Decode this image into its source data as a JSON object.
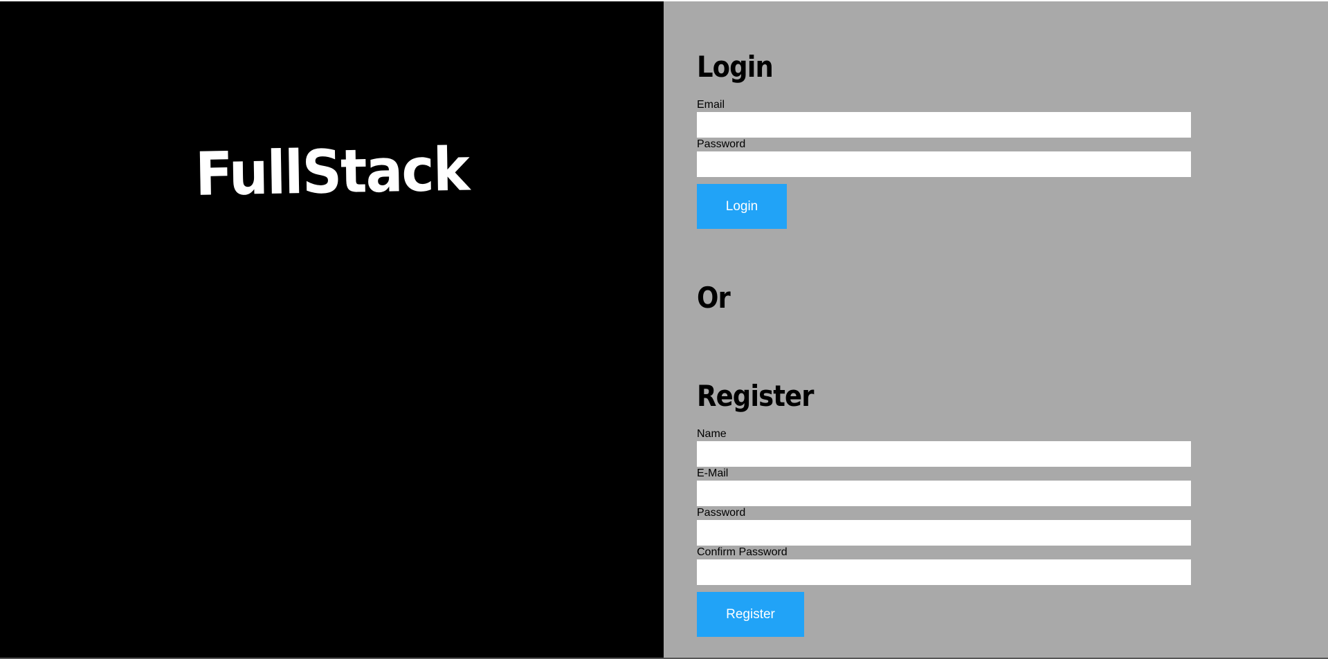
{
  "brand": {
    "title": "FullStack"
  },
  "login": {
    "heading": "Login",
    "email_label": "Email",
    "email_value": "",
    "password_label": "Password",
    "password_value": "",
    "button_label": "Login"
  },
  "separator": {
    "text": "Or"
  },
  "register": {
    "heading": "Register",
    "name_label": "Name",
    "name_value": "",
    "email_label": "E-Mail",
    "email_value": "",
    "password_label": "Password",
    "password_value": "",
    "confirm_label": "Confirm Password",
    "confirm_value": "",
    "button_label": "Register"
  },
  "colors": {
    "left_background": "#000000",
    "right_background": "#a9a9a9",
    "button_accent": "#21a3f7",
    "brand_text": "#ffffff"
  }
}
